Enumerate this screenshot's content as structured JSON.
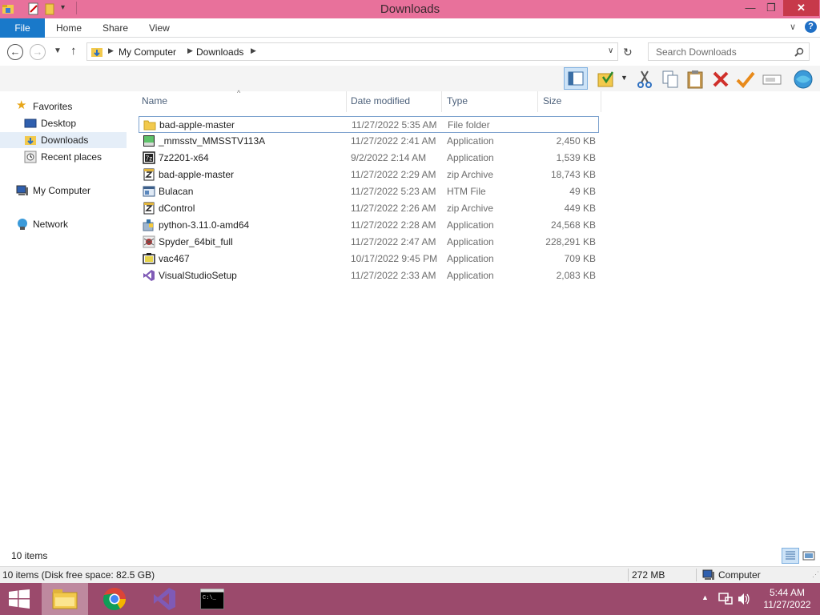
{
  "window": {
    "title": "Downloads",
    "controls": {
      "minimize": "—",
      "maximize": "❐",
      "close": "✕"
    }
  },
  "ribbon": {
    "file_tab": "File",
    "tabs": [
      "Home",
      "Share",
      "View"
    ]
  },
  "address": {
    "breadcrumb": [
      "My Computer",
      "Downloads"
    ],
    "search_placeholder": "Search Downloads"
  },
  "nav_pane": {
    "favorites_label": "Favorites",
    "favorites": [
      "Desktop",
      "Downloads",
      "Recent places"
    ],
    "selected": "Downloads",
    "my_computer": "My Computer",
    "network": "Network"
  },
  "file_list": {
    "columns": {
      "name": "Name",
      "date": "Date modified",
      "type": "Type",
      "size": "Size"
    },
    "rows": [
      {
        "name": "bad-apple-master",
        "date": "11/27/2022 5:35 AM",
        "type": "File folder",
        "size": "",
        "icon": "folder-icon"
      },
      {
        "name": "_mmsstv_MMSSTV113A",
        "date": "11/27/2022 2:41 AM",
        "type": "Application",
        "size": "2,450 KB",
        "icon": "app-icon"
      },
      {
        "name": "7z2201-x64",
        "date": "9/2/2022 2:14 AM",
        "type": "Application",
        "size": "1,539 KB",
        "icon": "7z-icon"
      },
      {
        "name": "bad-apple-master",
        "date": "11/27/2022 2:29 AM",
        "type": "zip Archive",
        "size": "18,743 KB",
        "icon": "zip-icon"
      },
      {
        "name": "Bulacan",
        "date": "11/27/2022 5:23 AM",
        "type": "HTM File",
        "size": "49 KB",
        "icon": "htm-icon"
      },
      {
        "name": "dControl",
        "date": "11/27/2022 2:26 AM",
        "type": "zip Archive",
        "size": "449 KB",
        "icon": "zip-icon"
      },
      {
        "name": "python-3.11.0-amd64",
        "date": "11/27/2022 2:28 AM",
        "type": "Application",
        "size": "24,568 KB",
        "icon": "python-icon"
      },
      {
        "name": "Spyder_64bit_full",
        "date": "11/27/2022 2:47 AM",
        "type": "Application",
        "size": "228,291 KB",
        "icon": "spyder-icon"
      },
      {
        "name": "vac467",
        "date": "10/17/2022 9:45 PM",
        "type": "Application",
        "size": "709 KB",
        "icon": "vac-icon"
      },
      {
        "name": "VisualStudioSetup",
        "date": "11/27/2022 2:33 AM",
        "type": "Application",
        "size": "2,083 KB",
        "icon": "visual-studio-icon"
      }
    ]
  },
  "status": {
    "item_count": "10 items",
    "disk_info": "10 items (Disk free space: 82.5 GB)",
    "memory": "272 MB",
    "location": "Computer"
  },
  "taskbar": {
    "apps": [
      "file-explorer-icon",
      "chrome-icon",
      "visual-studio-icon",
      "command-prompt-icon"
    ],
    "time": "5:44 AM",
    "date": "11/27/2022"
  },
  "colors": {
    "title_bar": "#e8719b",
    "taskbar": "#9b4a6c",
    "file_tab": "#1979ca",
    "close_button": "#c7394a"
  }
}
